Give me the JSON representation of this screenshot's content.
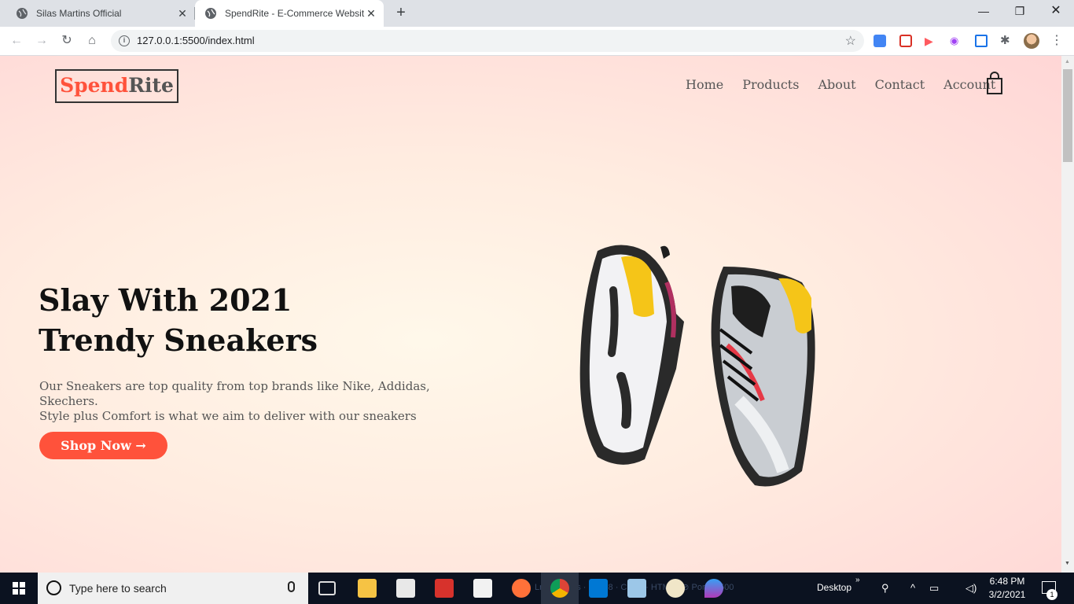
{
  "browser": {
    "tabs": [
      {
        "title": "Silas Martins Official",
        "active": false
      },
      {
        "title": "SpendRite - E-Commerce Websit",
        "active": true
      }
    ],
    "new_tab_label": "+",
    "url": "127.0.0.1:5500/index.html"
  },
  "site": {
    "logo": {
      "part1": "Spend",
      "part2": "Rite"
    },
    "nav": [
      "Home",
      "Products",
      "About",
      "Contact",
      "Account"
    ],
    "hero": {
      "title_line1": "Slay With 2021",
      "title_line2": "Trendy Sneakers",
      "desc_line1": "Our Sneakers are top quality from top brands like Nike, Addidas, Skechers.",
      "desc_line2": "Style plus Comfort is what we aim to deliver with our sneakers",
      "cta": "Shop Now →"
    },
    "colors": {
      "accent": "#ff523b",
      "heading": "#111111",
      "body_text": "#555555"
    }
  },
  "taskbar": {
    "search_placeholder": "Type here to search",
    "desktop_label": "Desktop",
    "time": "6:48 PM",
    "date": "3/2/2021",
    "notification_count": "1"
  }
}
